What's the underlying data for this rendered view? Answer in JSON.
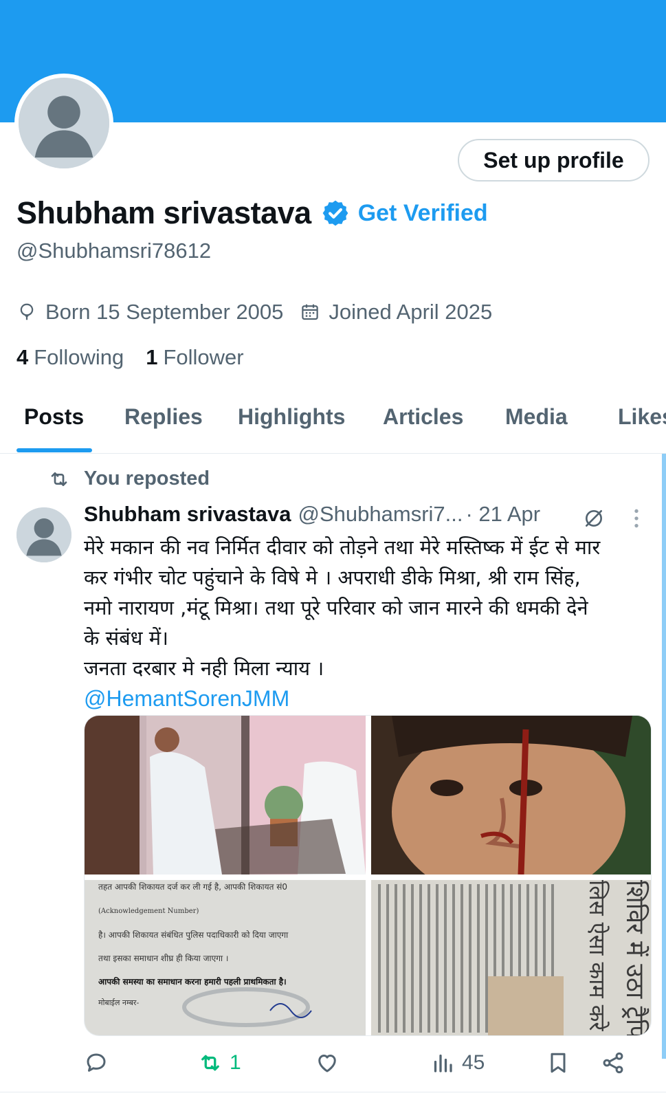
{
  "profile": {
    "name": "Shubham srivastava",
    "handle": "@Shubhamsri78612",
    "get_verified_label": "Get Verified",
    "setup_button_label": "Set up profile",
    "birth": "Born 15 September 2005",
    "joined": "Joined April 2025",
    "following_count": "4",
    "following_label": "Following",
    "followers_count": "1",
    "followers_label": "Follower",
    "banner_color": "#1d9bf0"
  },
  "tabs": [
    {
      "label": "Posts",
      "active": true
    },
    {
      "label": "Replies"
    },
    {
      "label": "Highlights"
    },
    {
      "label": "Articles"
    },
    {
      "label": "Media"
    },
    {
      "label": "Likes"
    }
  ],
  "post": {
    "repost_label": "You reposted",
    "author_name": "Shubham srivastava",
    "author_handle": "@Shubhamsri7...",
    "date": "· 21 Apr",
    "text_lines": [
      "मेरे मकान की नव निर्मित दीवार को तोड़ने तथा मेरे मस्तिष्क में ईट से मार",
      "कर गंभीर चोट पहुंचाने के विषे मे । अपराधी डीके मिश्रा, श्री राम सिंह,",
      "नमो नारायण ,मंटू मिश्रा।  तथा पूरे परिवार को जान मारने की धमकी  देने",
      "के संबंध में।",
      "जनता दरबार मे नही मिला न्याय ।"
    ],
    "mention": "@HemantSorenJMM",
    "media": [
      {
        "icon": "photo-house-wall"
      },
      {
        "icon": "photo-injured-face"
      },
      {
        "icon": "photo-complaint-receipt",
        "lines": [
          "तहत आपकी शिकायत दर्ज कर ली गई है, आपकी शिकायत सं0",
          "(Acknowledgement Number)",
          "है। आपकी शिकायत संबंधित पुलिस पदाधिकारी को दिया जाएगा",
          "तथा इसका समाधान शीघ्र ही किया जाएगा ।",
          "आपकी समस्या  का समाधान करना हमारी पहली प्राथमिकता है।",
          "मोबाईल नम्बर-"
        ]
      },
      {
        "icon": "photo-newspaper-clip",
        "headline": "शिविर में उठा ट्रैफिक",
        "subhead": "लिस ऐसा काम करे"
      }
    ],
    "replies_count": "",
    "reposts_count": "1",
    "likes_count": "",
    "views_count": "45"
  },
  "colors": {
    "accent": "#1d9bf0",
    "repost_green": "#00ba7c",
    "secondary_text": "#536471"
  }
}
